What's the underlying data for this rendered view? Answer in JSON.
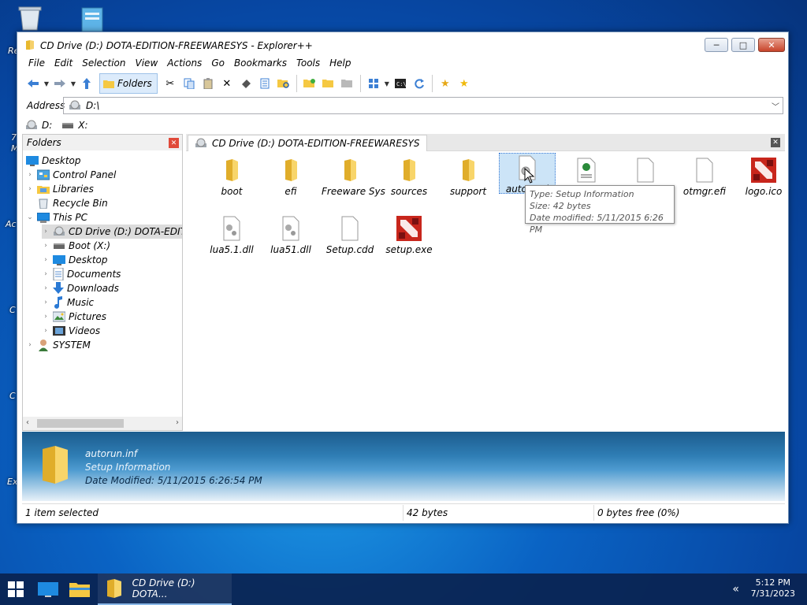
{
  "desktop": {
    "left_labels": [
      "Re",
      "7",
      "M",
      "Ac",
      "C",
      "C",
      "Ex"
    ]
  },
  "window": {
    "title": "CD Drive (D:) DOTA-EDITION-FREEWARESYS - Explorer++",
    "controls": {
      "minimize": "─",
      "maximize": "□",
      "close": "✕"
    }
  },
  "menu": [
    "File",
    "Edit",
    "Selection",
    "View",
    "Actions",
    "Go",
    "Bookmarks",
    "Tools",
    "Help"
  ],
  "toolbar": {
    "folders_label": "Folders"
  },
  "address": {
    "label": "Address",
    "value": "D:\\"
  },
  "drives": [
    {
      "label": "D:"
    },
    {
      "label": "X:"
    }
  ],
  "folders_pane": {
    "title": "Folders",
    "tree": [
      {
        "label": "Desktop"
      },
      {
        "label": "Control Panel"
      },
      {
        "label": "Libraries"
      },
      {
        "label": "Recycle Bin"
      },
      {
        "label": "This PC"
      },
      {
        "label": "CD Drive (D:) DOTA-EDITI"
      },
      {
        "label": "Boot (X:)"
      },
      {
        "label": "Desktop"
      },
      {
        "label": "Documents"
      },
      {
        "label": "Downloads"
      },
      {
        "label": "Music"
      },
      {
        "label": "Pictures"
      },
      {
        "label": "Videos"
      },
      {
        "label": "SYSTEM"
      }
    ]
  },
  "tab": {
    "label": "CD Drive (D:) DOTA-EDITION-FREEWARESYS"
  },
  "files": [
    {
      "name": "boot",
      "icon": "folder-icon"
    },
    {
      "name": "efi",
      "icon": "folder-icon"
    },
    {
      "name": "Freeware Sys",
      "icon": "folder-icon"
    },
    {
      "name": "sources",
      "icon": "folder-icon"
    },
    {
      "name": "support",
      "icon": "folder-icon"
    },
    {
      "name": "autorun.i",
      "icon": "settings-file-icon"
    },
    {
      "name": "",
      "icon": "web-file-icon"
    },
    {
      "name": "",
      "icon": "blank-file-icon"
    },
    {
      "name": "otmgr.efi",
      "icon": "blank-file-icon"
    },
    {
      "name": "logo.ico",
      "icon": "dota-logo-icon"
    },
    {
      "name": "lua5.1.dll",
      "icon": "dll-file-icon"
    },
    {
      "name": "lua51.dll",
      "icon": "dll-file-icon"
    },
    {
      "name": "Setup.cdd",
      "icon": "blank-file-icon"
    },
    {
      "name": "setup.exe",
      "icon": "dota-logo-icon"
    }
  ],
  "tooltip": {
    "type": "Type: Setup Information",
    "size": "Size: 42 bytes",
    "modified": "Date modified: 5/11/2015 6:26 PM"
  },
  "info": {
    "name": "autorun.inf",
    "type": "Setup Information",
    "modified": "Date Modified: 5/11/2015 6:26:54 PM"
  },
  "status": {
    "selected": "1 item selected",
    "size": "42 bytes",
    "free": "0 bytes free (0%)"
  },
  "taskbar": {
    "task_label": "CD Drive (D:) DOTA...",
    "time": "5:12 PM",
    "date": "7/31/2023",
    "tray_chevron": "«"
  },
  "colors": {
    "accent": "#0a63c4",
    "folder": "#f5c842",
    "selection": "#cce4f7",
    "dota_red": "#c8261c"
  }
}
